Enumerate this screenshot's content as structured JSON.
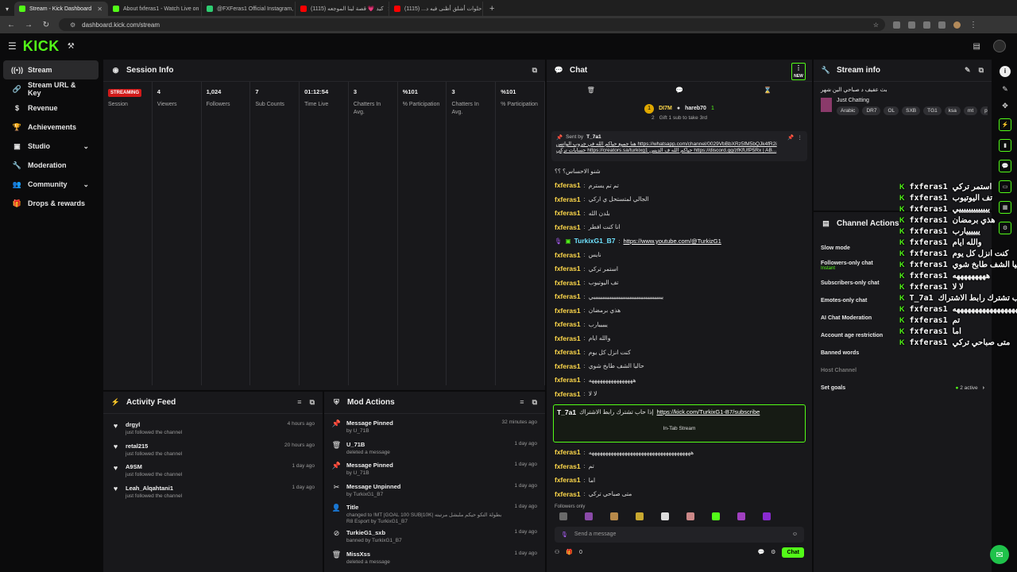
{
  "browser": {
    "tabs": [
      {
        "title": "Stream - Kick Dashboard",
        "color": "#53fc18",
        "active": true
      },
      {
        "title": "About fxferas1 - Watch Live on",
        "color": "#53fc18",
        "active": false
      },
      {
        "title": "@FXFeras1 Official Instagram,",
        "color": "#2ecc71",
        "active": false
      },
      {
        "title": "كيد 💗 قصة لينا الموجعه (1115)",
        "color": "#ff0000",
        "active": false
      },
      {
        "title": "حلوات أشلق أظنى فيه د... (1115)",
        "color": "#ff0000",
        "active": false
      }
    ],
    "url": "dashboard.kick.com/stream"
  },
  "kick": {
    "logo": "KICK"
  },
  "sidebar": {
    "items": [
      {
        "label": "Stream",
        "icon": "broadcast-icon",
        "active": true
      },
      {
        "label": "Stream URL & Key",
        "icon": "key-icon"
      },
      {
        "label": "Revenue",
        "icon": "dollar-icon"
      },
      {
        "label": "Achievements",
        "icon": "trophy-icon"
      },
      {
        "label": "Studio",
        "icon": "studio-icon",
        "chevron": true
      },
      {
        "label": "Moderation",
        "icon": "wrench-icon"
      },
      {
        "label": "Community",
        "icon": "community-icon",
        "chevron": true
      },
      {
        "label": "Drops & rewards",
        "icon": "gift-icon"
      }
    ]
  },
  "session": {
    "title": "Session Info",
    "status": "STREAMING",
    "columns": [
      {
        "value": "",
        "label": "Session"
      },
      {
        "value": "4",
        "label": "Viewers"
      },
      {
        "value": "1,024",
        "label": "Followers"
      },
      {
        "value": "7",
        "label": "Sub Counts"
      },
      {
        "value": "01:12:54",
        "label": "Time Live"
      },
      {
        "value": "3",
        "label": "Chatters In Avg."
      },
      {
        "value": "%101",
        "label": "% Participation"
      },
      {
        "value": "3",
        "label": "Chatters In Avg."
      },
      {
        "value": "%101",
        "label": "% Participation"
      }
    ]
  },
  "activity": {
    "title": "Activity Feed",
    "items": [
      {
        "name": "drgyl",
        "sub": "just followed the channel",
        "time": "4 hours ago"
      },
      {
        "name": "retal215",
        "sub": "just followed the channel",
        "time": "20 hours ago"
      },
      {
        "name": "A9SM",
        "sub": "just followed the channel",
        "time": "1 day ago"
      },
      {
        "name": "Leah_Alqahtani1",
        "sub": "just followed the channel",
        "time": "1 day ago"
      }
    ]
  },
  "mod": {
    "title": "Mod Actions",
    "items": [
      {
        "name": "Message Pinned",
        "sub": "by U_71B",
        "time": "32 minutes ago",
        "icon": "pin-icon"
      },
      {
        "name": "U_71B",
        "sub": "deleted a message",
        "time": "1 day ago",
        "icon": "trash-icon"
      },
      {
        "name": "Message Pinned",
        "sub": "by U_71B",
        "time": "1 day ago",
        "icon": "pin-icon"
      },
      {
        "name": "Message Unpinned",
        "sub": "by TurkixG1_B7",
        "time": "1 day ago",
        "icon": "unpin-icon"
      },
      {
        "name": "Title",
        "sub": "changed to !MT |GOAL 100 SUB|10K| بطولة التكو حيكم ملبشل مرتبته R8 Esport by TurkixG1_B7",
        "time": "1 day ago",
        "icon": "title-icon"
      },
      {
        "name": "TurkieG1_sxb",
        "sub": "banned by TurkixG1_B7",
        "time": "1 day ago",
        "icon": "ban-icon"
      },
      {
        "name": "MissXss",
        "sub": "deleted a message",
        "time": "1 day ago",
        "icon": "trash-icon"
      }
    ]
  },
  "chat": {
    "title": "Chat",
    "new_label": "NEW",
    "top_user": "DI7M",
    "top_user2": "hareb70",
    "top_count": "2",
    "top_count2": "1",
    "gift_text": "Gift 1 sub to take 3rd",
    "pinned_by": "Sent by",
    "pinned_user": "T_7a1",
    "pinned_line1": "هنا جميع حياكم الله في جروب الواتس https://whatsapp.com/channel/0029VbBbXRz5fM5bQJk4fR2i",
    "pinned_line2": "حسابات تركي https://creators.sa/turkixg1 حياكم الله ف الديس https://discord.gg/zfKfUfP5Rx | AB...",
    "messages": [
      {
        "user": "",
        "text": "شنو الاحساس؟ ؟؟"
      },
      {
        "user": "fxferas1",
        "text": "تم تم يسترم"
      },
      {
        "user": "fxferas1",
        "text": "الجالي لمتستحل ي اركي"
      },
      {
        "user": "fxferas1",
        "text": "بلدن الله"
      },
      {
        "user": "fxferas1",
        "text": "انا كنت افطر"
      },
      {
        "user": "TurkixG1_B7",
        "text": "",
        "link": "https://www.youtube.com/@TurkizG1"
      },
      {
        "user": "fxferas1",
        "text": "نايس"
      },
      {
        "user": "fxferas1",
        "text": "استمر تركي"
      },
      {
        "user": "fxferas1",
        "text": "تف اليوتيوب"
      },
      {
        "user": "fxferas1",
        "text": "يييييييييييييييييييييييييييييييييييييييي"
      },
      {
        "user": "fxferas1",
        "text": "هذي برمضان"
      },
      {
        "user": "fxferas1",
        "text": "يييييارب"
      },
      {
        "user": "fxferas1",
        "text": "والله ايام"
      },
      {
        "user": "fxferas1",
        "text": "كنت انزل كل يوم"
      },
      {
        "user": "fxferas1",
        "text": "حاليا الشف طابخ شوي"
      },
      {
        "user": "fxferas1",
        "text": "ههههههههههههههههه"
      },
      {
        "user": "fxferas1",
        "text": "لا لا"
      }
    ],
    "highlight": {
      "user": "T_7a1",
      "text": "إذا حاب تشترك رابط الاشتراك",
      "link": "https://kick.com/TurkixG1-B7/subscribe",
      "tag": "In-Tab Stream"
    },
    "messages2": [
      {
        "user": "fxferas1",
        "text": "هههههههههههههههههههههههههههههههههههههه"
      },
      {
        "user": "fxferas1",
        "text": "تم"
      },
      {
        "user": "fxferas1",
        "text": "اما"
      },
      {
        "user": "fxferas1",
        "text": "متى صباحي تركي"
      }
    ],
    "followers_only": "Followers only",
    "input_placeholder": "Send a message",
    "viewer_count": "0",
    "send_label": "Chat"
  },
  "stream_info": {
    "title": "Stream info",
    "stream_title": "بث عفيف د صباحي الين شهر",
    "category": "Just Chatting",
    "tags": [
      "Arabic",
      "DR7",
      "OL",
      "SXB",
      "TG1",
      "ksa",
      "mt",
      "pi"
    ]
  },
  "channel_actions": {
    "title": "Channel Actions",
    "items": [
      {
        "label": "Slow mode",
        "sub": ""
      },
      {
        "label": "Followers-only chat",
        "sub": "Instant"
      },
      {
        "label": "Subscribers-only chat",
        "sub": ""
      },
      {
        "label": "Emotes-only chat",
        "sub": ""
      },
      {
        "label": "AI Chat Moderation",
        "sub": ""
      },
      {
        "label": "Account age restriction",
        "sub": ""
      },
      {
        "label": "Banned words",
        "sub": ""
      },
      {
        "label": "Host Channel",
        "sub": ""
      },
      {
        "label": "Set goals",
        "sub": ""
      }
    ],
    "goals_active": "2 active"
  },
  "overlay": {
    "lines": [
      {
        "user": "fxferas1",
        "text": "استمر تركي"
      },
      {
        "user": "fxferas1",
        "text": "تف اليوتيوب"
      },
      {
        "user": "fxferas1",
        "text": "يييييييييييييي"
      },
      {
        "user": "fxferas1",
        "text": "هذي برمضان"
      },
      {
        "user": "fxferas1",
        "text": "ييييييارب"
      },
      {
        "user": "fxferas1",
        "text": "والله ايام"
      },
      {
        "user": "fxferas1",
        "text": "كنت انزل كل يوم"
      },
      {
        "user": "fxferas1",
        "text": "حاليا الشف طابخ شوي"
      },
      {
        "user": "fxferas1",
        "text": "هههههههههه"
      },
      {
        "user": "fxferas1",
        "text": "لا لا"
      },
      {
        "user": "T_7a1",
        "text": "اذا حاب تشترك رابط الاشتراك https://kick.com/TurkixG1-B7/subscribe"
      },
      {
        "user": "fxferas1",
        "text": "ههههههههههههههههههه"
      },
      {
        "user": "fxferas1",
        "text": "تم"
      },
      {
        "user": "fxferas1",
        "text": "اما"
      },
      {
        "user": "fxferas1",
        "text": "متى صباحي تركي"
      }
    ]
  },
  "colors": {
    "accent": "#53fc18",
    "live": "#d11a1a",
    "panel": "#18181b",
    "username": "#ffd84a"
  }
}
